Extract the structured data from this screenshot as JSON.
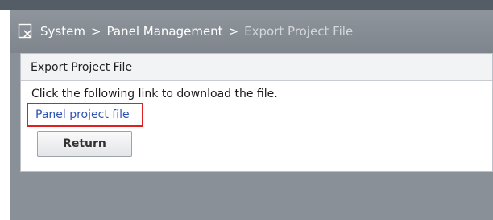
{
  "breadcrumb": {
    "icon": "export-document-icon",
    "items": [
      "System",
      "Panel Management",
      "Export Project File"
    ],
    "separator": ">"
  },
  "panel": {
    "title": "Export Project File",
    "instruction": "Click the following link to download the file.",
    "link_label": "Panel project file",
    "return_label": "Return"
  },
  "colors": {
    "link": "#2f53b5",
    "highlight_box": "#e0201e",
    "header_bar": "#545c66",
    "breadcrumb_bg": "#8a9097"
  }
}
